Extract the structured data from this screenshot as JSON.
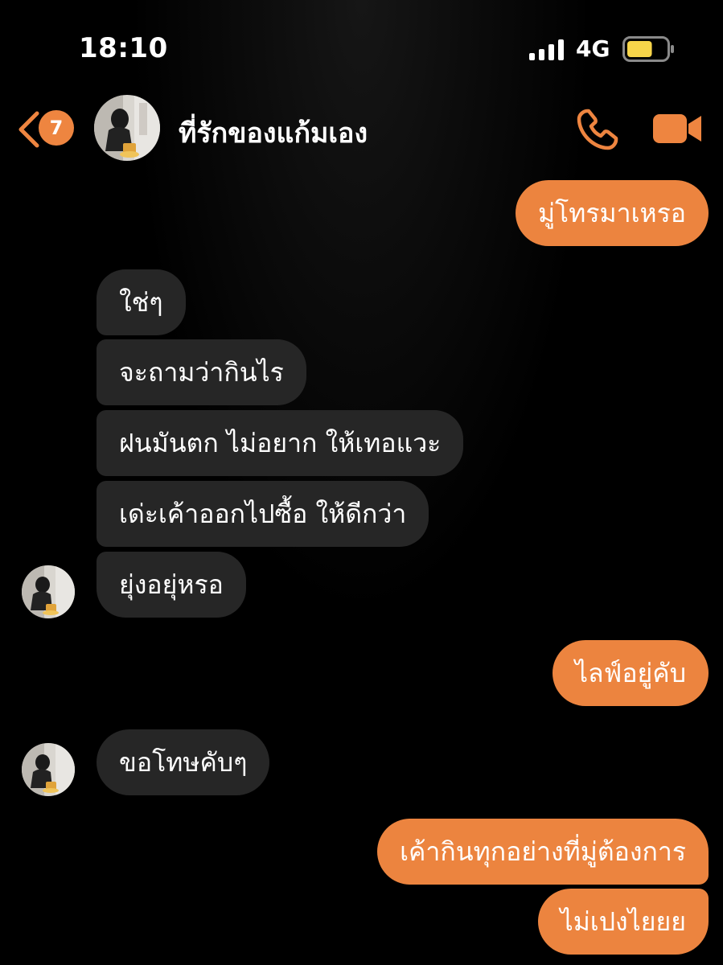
{
  "status_bar": {
    "time": "18:10",
    "network": "4G",
    "signal_icon": "signal-bars-icon",
    "battery_icon": "battery-icon",
    "battery_level": 0.65
  },
  "header": {
    "back_icon": "chevron-left-icon",
    "unread_count": "7",
    "contact_name": "ที่รักของแก้มเอง",
    "call_icon": "phone-icon",
    "video_icon": "video-camera-icon"
  },
  "messages": [
    {
      "direction": "outgoing",
      "text": "มู่โทรมาเหรอ"
    },
    {
      "direction": "incoming",
      "text": "ใช่ๆ"
    },
    {
      "direction": "incoming",
      "text": "จะถามว่ากินไร"
    },
    {
      "direction": "incoming",
      "text": "ฝนมันตก ไม่อยาก ให้เทอแวะ"
    },
    {
      "direction": "incoming",
      "text": "เด่ะเค้าออกไปซื้อ ให้ดีกว่า"
    },
    {
      "direction": "incoming",
      "text": "ยุ่งอยุ่หรอ"
    },
    {
      "direction": "outgoing",
      "text": "ไลฟ์อยู่คับ"
    },
    {
      "direction": "incoming",
      "text": "ขอโทษคับๆ"
    },
    {
      "direction": "outgoing",
      "text": "เค้ากินทุกอย่างที่มู่ต้องการ"
    },
    {
      "direction": "outgoing",
      "text": "ไม่เปงไยยย"
    }
  ],
  "colors": {
    "accent": "#ec843f",
    "incoming_bubble": "#262626",
    "background": "#000000",
    "battery_fill": "#f7d54a"
  }
}
